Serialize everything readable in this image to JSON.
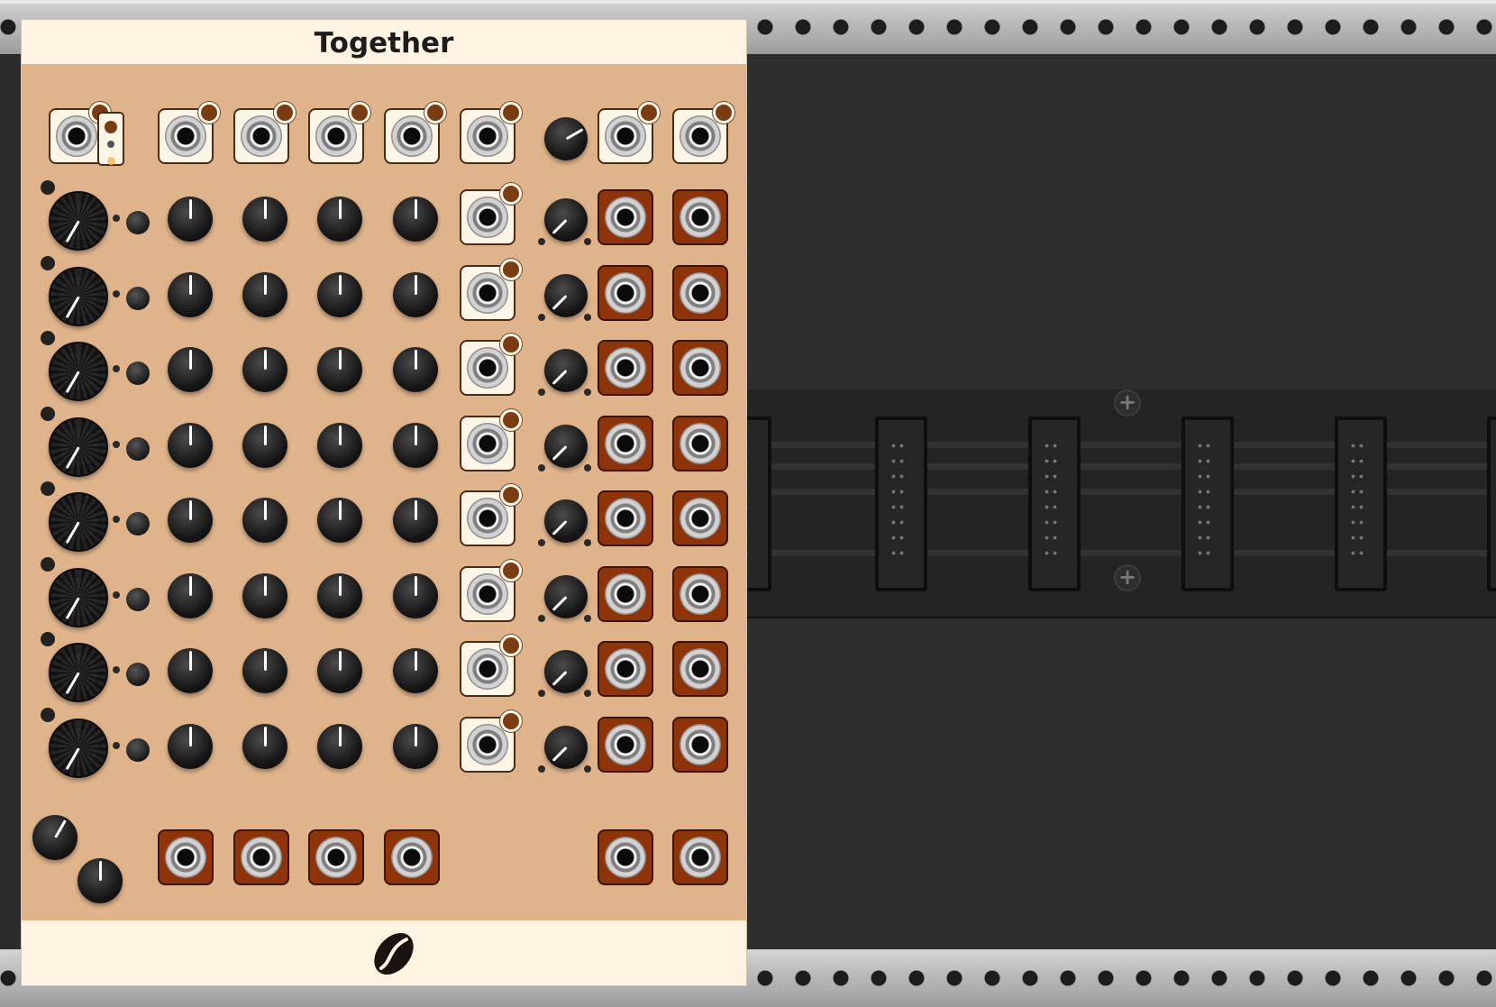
{
  "module": {
    "title": "Together",
    "brand_logo": "coffee-bean-logo",
    "colors": {
      "panel": "#dfb48b",
      "header": "#fff4e2",
      "output_jack": "#8f3309",
      "input_jack": "#fdf5e6",
      "led": "#7a3c10"
    }
  },
  "channels": 8,
  "rack": {
    "rail_color": "#b9b9b9",
    "background": "#2b2b2b"
  }
}
